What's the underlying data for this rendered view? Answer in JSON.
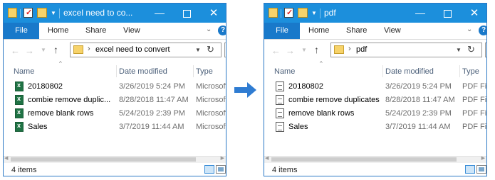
{
  "colors": {
    "accent": "#1979ca",
    "titlebar": "#1c8fdc",
    "arrow": "#2f7cd2"
  },
  "ribbon": {
    "file": "File",
    "home": "Home",
    "share": "Share",
    "view": "View"
  },
  "columns": {
    "name": "Name",
    "date": "Date modified",
    "type": "Type"
  },
  "left": {
    "title": "excel need to co...",
    "address": "excel need to convert",
    "status": "4 items",
    "files": [
      {
        "name": "20180802",
        "date": "3/26/2019 5:24 PM",
        "type": "Microsoft E",
        "icon": "excel-file-icon"
      },
      {
        "name": "combie remove duplic...",
        "date": "8/28/2018 11:47 AM",
        "type": "Microsoft E",
        "icon": "excel-file-icon"
      },
      {
        "name": "remove blank rows",
        "date": "5/24/2019 2:39 PM",
        "type": "Microsoft E",
        "icon": "excel-file-icon"
      },
      {
        "name": "Sales",
        "date": "3/7/2019 11:44 AM",
        "type": "Microsoft E",
        "icon": "excel-file-icon"
      }
    ]
  },
  "right": {
    "title": "pdf",
    "address": "pdf",
    "status": "4 items",
    "files": [
      {
        "name": "20180802",
        "date": "3/26/2019 5:24 PM",
        "type": "PDF File",
        "icon": "pdf-file-icon"
      },
      {
        "name": "combie remove duplicates",
        "date": "8/28/2018 11:47 AM",
        "type": "PDF File",
        "icon": "pdf-file-icon"
      },
      {
        "name": "remove blank rows",
        "date": "5/24/2019 2:39 PM",
        "type": "PDF File",
        "icon": "pdf-file-icon"
      },
      {
        "name": "Sales",
        "date": "3/7/2019 11:44 AM",
        "type": "PDF File",
        "icon": "pdf-file-icon"
      }
    ]
  }
}
